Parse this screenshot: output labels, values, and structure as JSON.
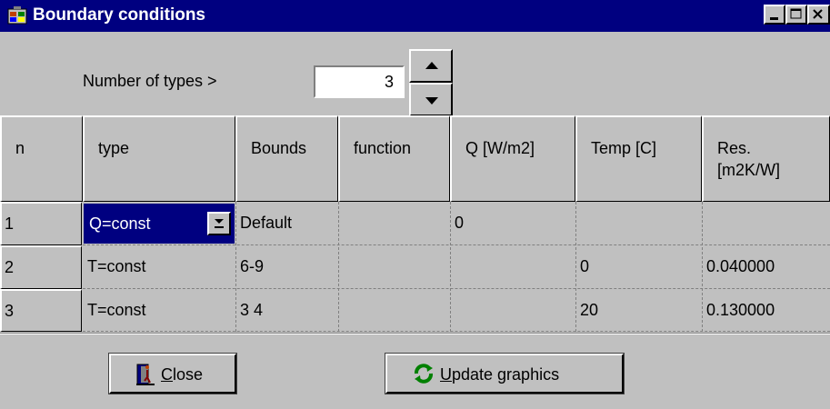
{
  "window": {
    "title": "Boundary conditions"
  },
  "types": {
    "label": "Number of types  >",
    "value": "3"
  },
  "grid": {
    "headers": [
      "n",
      "type",
      "Bounds",
      "function",
      "Q [W/m2]",
      "Temp  [C]",
      "Res.",
      "[m2K/W]"
    ],
    "rows": [
      {
        "n": "1",
        "type": "Q=const",
        "bounds": "Default",
        "function": "",
        "q": "0",
        "temp": "",
        "res": ""
      },
      {
        "n": "2",
        "type": "T=const",
        "bounds": "6-9",
        "function": "",
        "q": "",
        "temp": "0",
        "res": "0.040000"
      },
      {
        "n": "3",
        "type": "T=const",
        "bounds": "3 4",
        "function": "",
        "q": "",
        "temp": "20",
        "res": "0.130000"
      }
    ]
  },
  "buttons": {
    "close": {
      "accel": "C",
      "rest": "lose"
    },
    "update": {
      "accel": "U",
      "rest": "pdate graphics"
    }
  },
  "colors": {
    "titlebar": "#000080",
    "face": "#c0c0c0",
    "selection": "#000080"
  },
  "icons": [
    "app-icon",
    "minimize-icon",
    "maximize-icon",
    "close-icon",
    "spin-up-icon",
    "spin-down-icon",
    "dropdown-arrow-icon",
    "door-exit-icon",
    "refresh-icon"
  ]
}
